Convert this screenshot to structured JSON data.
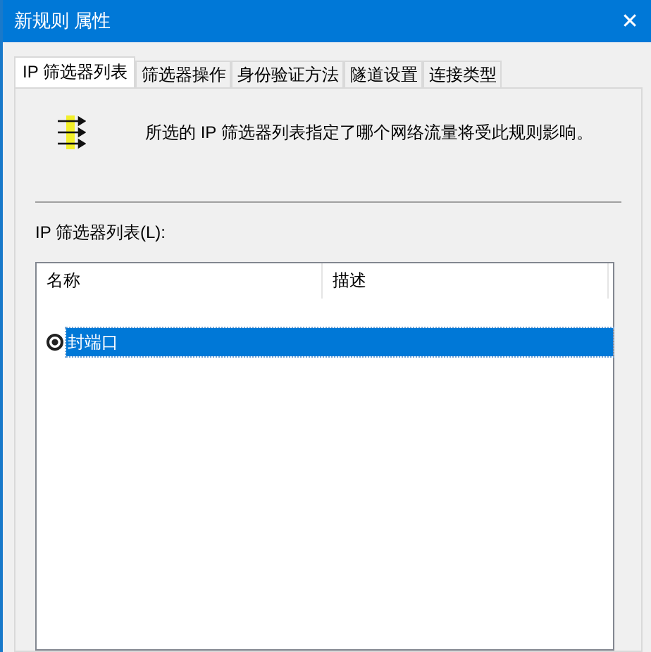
{
  "window": {
    "title": "新规则 属性",
    "close": "✕"
  },
  "tabs": [
    {
      "label": "IP 筛选器列表",
      "selected": true
    },
    {
      "label": "筛选器操作",
      "selected": false
    },
    {
      "label": "身份验证方法",
      "selected": false
    },
    {
      "label": "隧道设置",
      "selected": false
    },
    {
      "label": "连接类型",
      "selected": false
    }
  ],
  "description": "所选的 IP 筛选器列表指定了哪个网络流量将受此规则影响。",
  "list_label": "IP 筛选器列表(L):",
  "table": {
    "columns": [
      "名称",
      "描述"
    ],
    "rows": [
      {
        "name": "封端口",
        "checked": true,
        "selected": true
      }
    ]
  }
}
